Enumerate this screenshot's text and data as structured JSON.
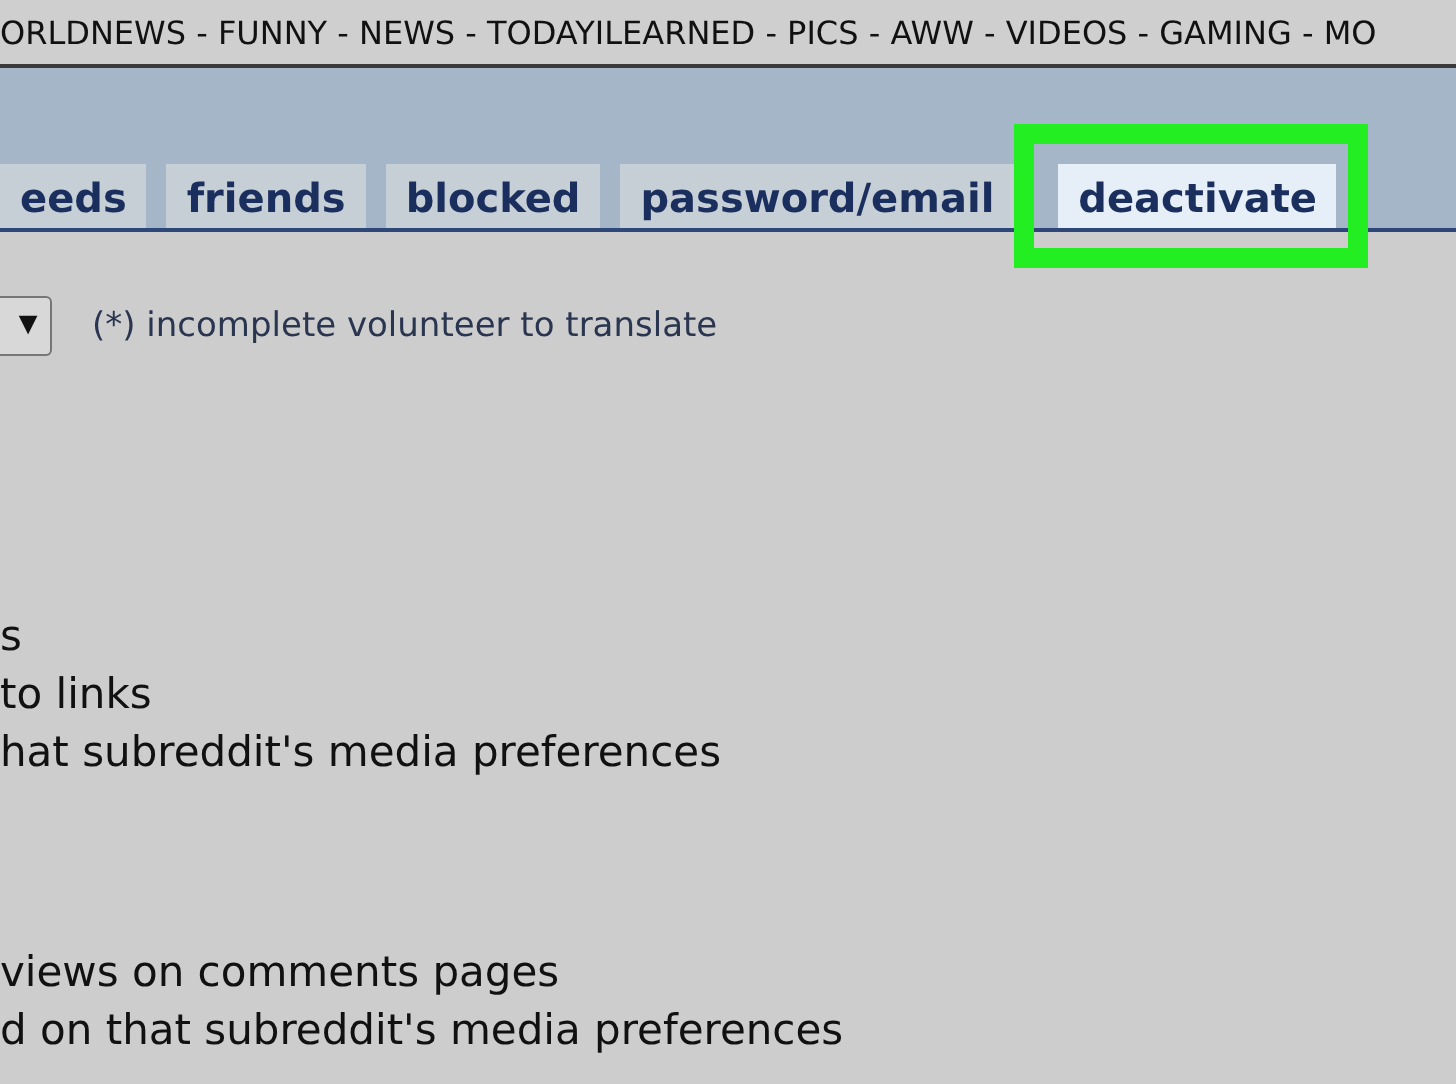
{
  "top_bar": {
    "text": "ORLDNEWS - FUNNY - NEWS - TODAYILEARNED - PICS - AWW - VIDEOS - GAMING - MO"
  },
  "tabs": [
    {
      "label": "eeds",
      "selected": false,
      "highlighted": false
    },
    {
      "label": "friends",
      "selected": false,
      "highlighted": false
    },
    {
      "label": "blocked",
      "selected": false,
      "highlighted": false
    },
    {
      "label": "password/email",
      "selected": false,
      "highlighted": false
    },
    {
      "label": "deactivate",
      "selected": true,
      "highlighted": true
    }
  ],
  "language": {
    "dropdown_arrow": "▼",
    "note": "(*) incomplete volunteer to translate"
  },
  "option_groups": [
    {
      "lines": [
        "s",
        "to links",
        "hat subreddit's media preferences"
      ]
    },
    {
      "lines": [
        "views on comments pages",
        "d on that subreddit's media preferences"
      ]
    }
  ]
}
